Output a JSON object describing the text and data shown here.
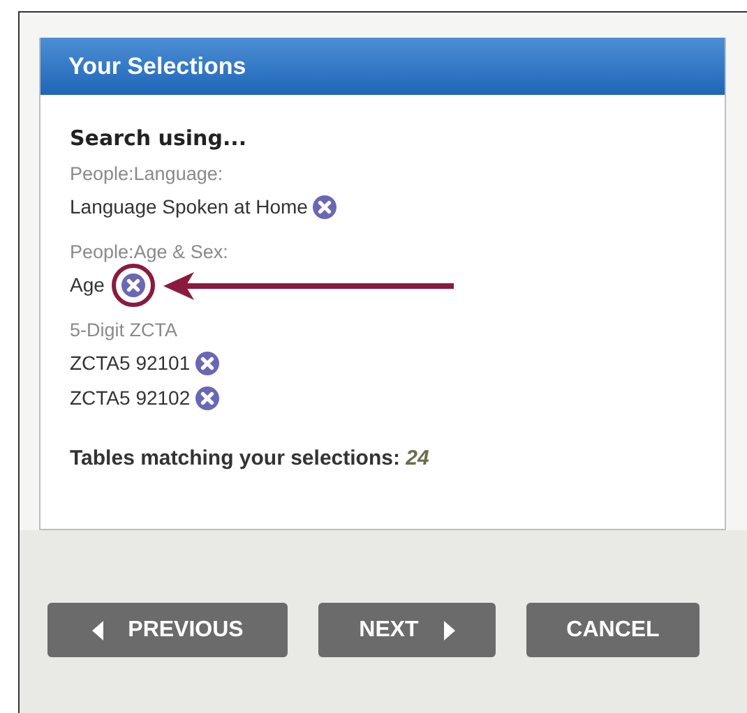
{
  "panel": {
    "title": "Your Selections",
    "heading": "Search using...",
    "groups": [
      {
        "label": "People:Language:",
        "values": [
          {
            "text": "Language Spoken at Home",
            "highlighted": false
          }
        ]
      },
      {
        "label": "People:Age & Sex:",
        "values": [
          {
            "text": "Age",
            "highlighted": true
          }
        ]
      },
      {
        "label": "5-Digit ZCTA",
        "values": [
          {
            "text": "ZCTA5 92101",
            "highlighted": false
          },
          {
            "text": "ZCTA5 92102",
            "highlighted": false
          }
        ]
      }
    ],
    "tables_label": "Tables matching your selections:",
    "tables_count": "24"
  },
  "buttons": [
    {
      "label": "PREVIOUS",
      "kind": "previous"
    },
    {
      "label": "NEXT",
      "kind": "next"
    },
    {
      "label": "CANCEL",
      "kind": "plain"
    }
  ]
}
